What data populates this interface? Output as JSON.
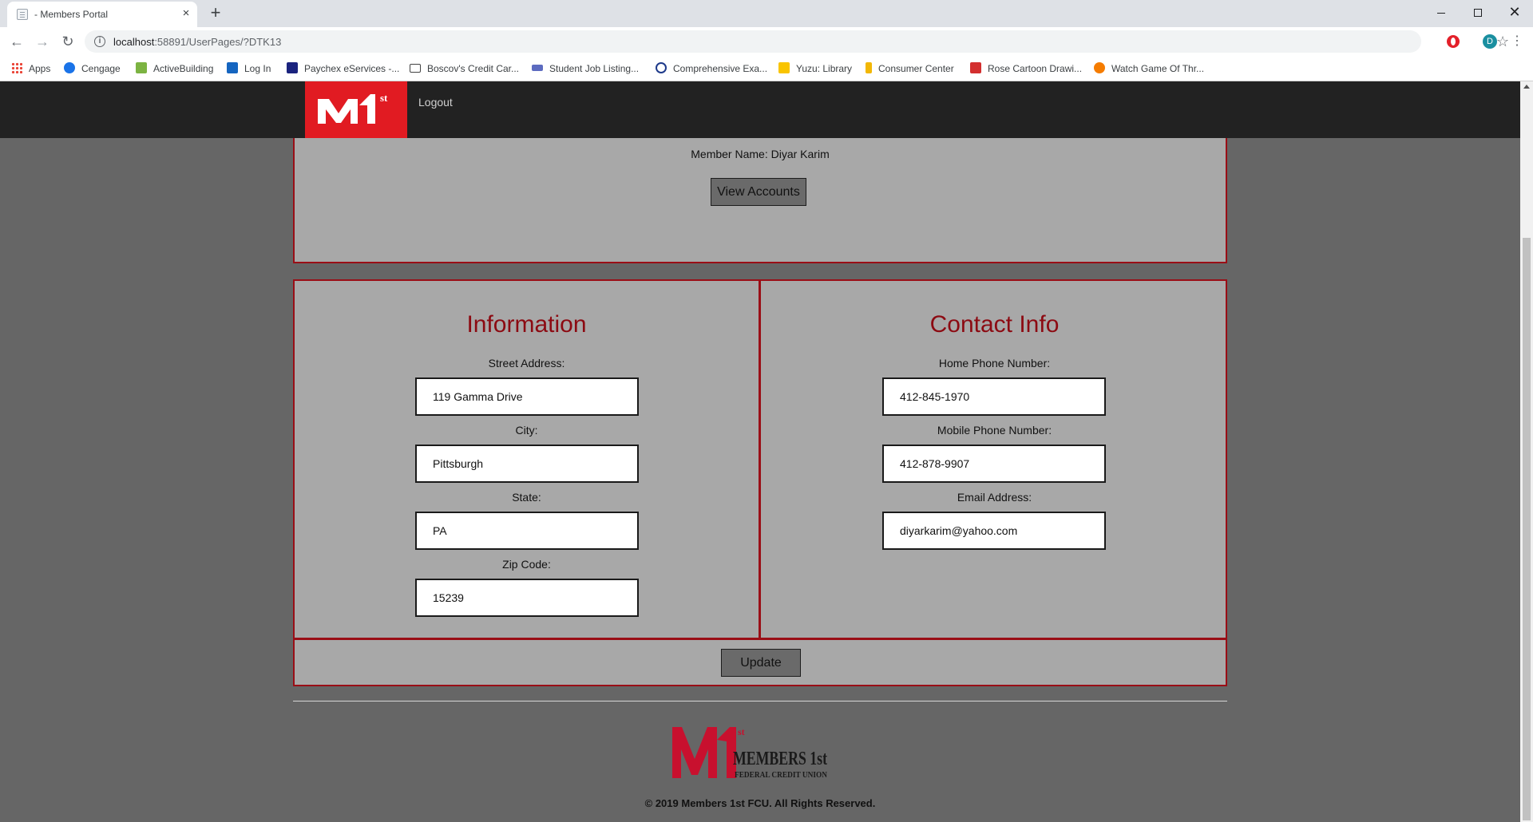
{
  "browser": {
    "tab_title": "- Members Portal",
    "tab_close": "×",
    "new_tab": "+",
    "url_host": "localhost",
    "url_path": ":58891/UserPages/?DTK13",
    "profile_initial": "D",
    "bookmarks": [
      {
        "label": "Apps",
        "icon": "apps-grid-icon",
        "color": "#ea4335"
      },
      {
        "label": "Cengage",
        "icon": "cengage-icon",
        "color": "#1a73e8"
      },
      {
        "label": "ActiveBuilding",
        "icon": "building-icon",
        "color": "#7cb342"
      },
      {
        "label": "Log In",
        "icon": "login-icon",
        "color": "#1565c0"
      },
      {
        "label": "Paychex eServices -...",
        "icon": "paychex-icon",
        "color": "#1a237e"
      },
      {
        "label": "Boscov's Credit Car...",
        "icon": "card-icon",
        "color": "#424242"
      },
      {
        "label": "Student Job Listing...",
        "icon": "job-icon",
        "color": "#5c6bc0"
      },
      {
        "label": "Comprehensive Exa...",
        "icon": "q-icon",
        "color": "#1e3a8a"
      },
      {
        "label": "Yuzu: Library",
        "icon": "yuzu-icon",
        "color": "#f9c400"
      },
      {
        "label": "Consumer Center",
        "icon": "consumer-icon",
        "color": "#f2b705"
      },
      {
        "label": "Rose Cartoon Drawi...",
        "icon": "rose-icon",
        "color": "#d32f2f"
      },
      {
        "label": "Watch Game Of Thr...",
        "icon": "watch-icon",
        "color": "#f57c00"
      }
    ]
  },
  "header": {
    "logo_text": "M1st",
    "logout_label": "Logout"
  },
  "member": {
    "name_label": "Member Name: Diyar Karim",
    "view_accounts_label": "View Accounts"
  },
  "information": {
    "title": "Information",
    "fields": [
      {
        "label": "Street Address:",
        "value": "119 Gamma Drive"
      },
      {
        "label": "City:",
        "value": "Pittsburgh"
      },
      {
        "label": "State:",
        "value": "PA"
      },
      {
        "label": "Zip Code:",
        "value": "15239"
      }
    ]
  },
  "contact": {
    "title": "Contact Info",
    "fields": [
      {
        "label": "Home Phone Number:",
        "value": "412-845-1970"
      },
      {
        "label": "Mobile Phone Number:",
        "value": "412-878-9907"
      },
      {
        "label": "Email Address:",
        "value": "diyarkarim@yahoo.com"
      }
    ]
  },
  "update_label": "Update",
  "footer": {
    "logo_main": "MEMBERS 1st",
    "logo_sub": "FEDERAL CREDIT UNION",
    "copyright": "© 2019 Members 1st FCU. All Rights Reserved."
  },
  "colors": {
    "brand_red": "#e11b22",
    "border_red": "#9a0e16",
    "panel_gray": "#a8a8a8",
    "page_gray": "#666666",
    "header_dark": "#222222"
  }
}
